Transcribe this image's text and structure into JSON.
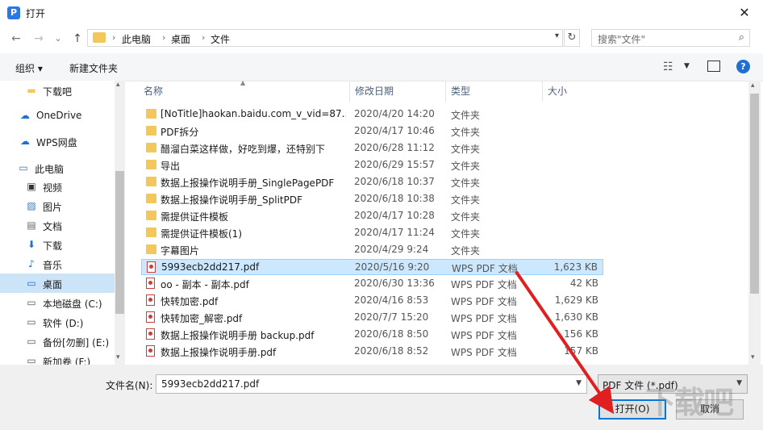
{
  "window": {
    "title": "打开",
    "close_glyph": "✕"
  },
  "nav": {
    "back_glyph": "←",
    "forward_glyph": "→",
    "recent_glyph": "⌄",
    "up_glyph": "↑",
    "breadcrumb": [
      "此电脑",
      "桌面",
      "文件"
    ],
    "separator": "›",
    "refresh_glyph": "↻",
    "search_placeholder": "搜索\"文件\""
  },
  "toolbar": {
    "organize_label": "组织 ▾",
    "new_folder_label": "新建文件夹"
  },
  "sidebar": {
    "items": [
      {
        "label": "下载吧",
        "icon": "folder-icon"
      },
      {
        "label": "OneDrive",
        "icon": "cloud-icon"
      },
      {
        "label": "WPS网盘",
        "icon": "cloud-outline-icon"
      },
      {
        "label": "此电脑",
        "icon": "computer-icon"
      },
      {
        "label": "视频",
        "icon": "video-icon"
      },
      {
        "label": "图片",
        "icon": "picture-icon"
      },
      {
        "label": "文档",
        "icon": "document-icon"
      },
      {
        "label": "下载",
        "icon": "download-icon"
      },
      {
        "label": "音乐",
        "icon": "music-icon"
      },
      {
        "label": "桌面",
        "icon": "desktop-icon",
        "selected": true
      },
      {
        "label": "本地磁盘 (C:)",
        "icon": "drive-icon"
      },
      {
        "label": "软件 (D:)",
        "icon": "drive-icon"
      },
      {
        "label": "备份[勿删] (E:)",
        "icon": "drive-icon"
      },
      {
        "label": "新加卷 (F:)",
        "icon": "drive-icon"
      }
    ]
  },
  "columns": {
    "name": "名称",
    "date": "修改日期",
    "type": "类型",
    "size": "大小"
  },
  "files": [
    {
      "name": "[NoTitle]haokan.baidu.com_v_vid=87...",
      "date": "2020/4/20 14:20",
      "type": "文件夹",
      "size": "",
      "kind": "folder"
    },
    {
      "name": "PDF拆分",
      "date": "2020/4/17 10:46",
      "type": "文件夹",
      "size": "",
      "kind": "folder"
    },
    {
      "name": "醋溜白菜这样做，好吃到爆，还特别下",
      "date": "2020/6/28 11:12",
      "type": "文件夹",
      "size": "",
      "kind": "folder"
    },
    {
      "name": "导出",
      "date": "2020/6/29 15:57",
      "type": "文件夹",
      "size": "",
      "kind": "folder"
    },
    {
      "name": "数据上报操作说明手册_SinglePagePDF",
      "date": "2020/6/18 10:37",
      "type": "文件夹",
      "size": "",
      "kind": "folder"
    },
    {
      "name": "数据上报操作说明手册_SplitPDF",
      "date": "2020/6/18 10:38",
      "type": "文件夹",
      "size": "",
      "kind": "folder"
    },
    {
      "name": "需提供证件模板",
      "date": "2020/4/17 10:28",
      "type": "文件夹",
      "size": "",
      "kind": "folder"
    },
    {
      "name": "需提供证件模板(1)",
      "date": "2020/4/17 11:24",
      "type": "文件夹",
      "size": "",
      "kind": "folder"
    },
    {
      "name": "字幕图片",
      "date": "2020/4/29 9:24",
      "type": "文件夹",
      "size": "",
      "kind": "folder"
    },
    {
      "name": "5993ecb2dd217.pdf",
      "date": "2020/5/16 9:20",
      "type": "WPS PDF 文档",
      "size": "1,623 KB",
      "kind": "pdf",
      "selected": true
    },
    {
      "name": "oo - 副本 - 副本.pdf",
      "date": "2020/6/30 13:36",
      "type": "WPS PDF 文档",
      "size": "42 KB",
      "kind": "pdf"
    },
    {
      "name": "快转加密.pdf",
      "date": "2020/4/16 8:53",
      "type": "WPS PDF 文档",
      "size": "1,629 KB",
      "kind": "pdf"
    },
    {
      "name": "快转加密_解密.pdf",
      "date": "2020/7/7 15:20",
      "type": "WPS PDF 文档",
      "size": "1,630 KB",
      "kind": "pdf"
    },
    {
      "name": "数据上报操作说明手册 backup.pdf",
      "date": "2020/6/18 8:50",
      "type": "WPS PDF 文档",
      "size": "156 KB",
      "kind": "pdf"
    },
    {
      "name": "数据上报操作说明手册.pdf",
      "date": "2020/6/18 8:52",
      "type": "WPS PDF 文档",
      "size": "157 KB",
      "kind": "pdf"
    }
  ],
  "bottom": {
    "filename_label": "文件名(N):",
    "filename_value": "5993ecb2dd217.pdf",
    "filter_value": "PDF 文件 (*.pdf)",
    "open_label": "打开(O)",
    "cancel_label": "取消"
  },
  "watermark": "下载吧",
  "colors": {
    "accent": "#0078d7",
    "selection": "#cce8ff",
    "arrow": "#e02020"
  }
}
